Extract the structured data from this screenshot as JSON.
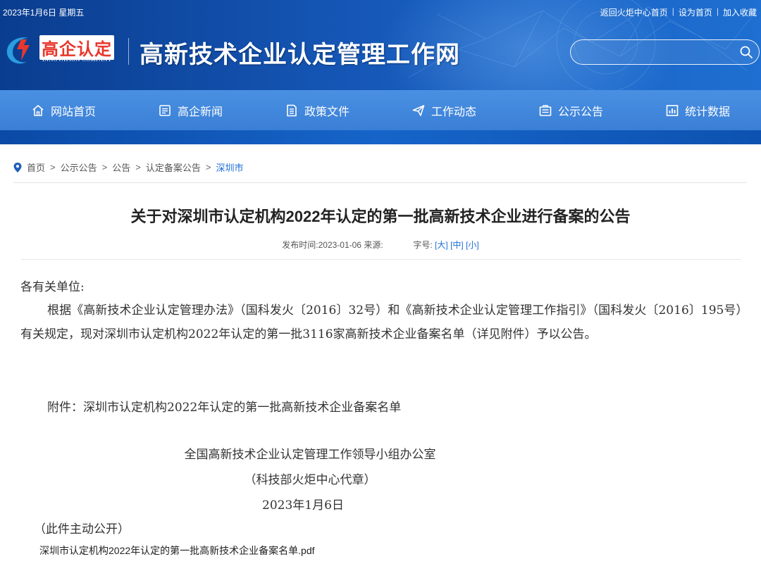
{
  "topbar": {
    "date": "2023年1月6日 星期五",
    "links": [
      "返回火炬中心首页",
      "设为首页",
      "加入收藏"
    ]
  },
  "logo": {
    "text": "高企认定",
    "sub": "INNOVATION COMPANY",
    "brand_color": "#e8372c"
  },
  "site_title": "高新技术企业认定管理工作网",
  "search": {
    "placeholder": ""
  },
  "nav": {
    "items": [
      {
        "label": "网站首页",
        "icon": "home-icon"
      },
      {
        "label": "高企新闻",
        "icon": "news-icon"
      },
      {
        "label": "政策文件",
        "icon": "document-icon"
      },
      {
        "label": "工作动态",
        "icon": "send-icon"
      },
      {
        "label": "公示公告",
        "icon": "announcement-icon"
      },
      {
        "label": "统计数据",
        "icon": "chart-icon"
      }
    ]
  },
  "breadcrumb": {
    "items": [
      "首页",
      "公示公告",
      "公告",
      "认定备案公告"
    ],
    "current": "深圳市",
    "separator": ">"
  },
  "article": {
    "title": "关于对深圳市认定机构2022年认定的第一批高新技术企业进行备案的公告",
    "meta": {
      "published_label": "发布时间:",
      "published_date": "2023-01-06",
      "source_label": "来源:",
      "font_size_label": "字号:",
      "size_large": "[大]",
      "size_medium": "[中]",
      "size_small": "[小]"
    },
    "salutation": "各有关单位:",
    "paragraph": "根据《高新技术企业认定管理办法》（国科发火〔2016〕32号）和《高新技术企业认定管理工作指引》（国科发火〔2016〕195号）有关规定，现对深圳市认定机构2022年认定的第一批3116家高新技术企业备案名单（详见附件）予以公告。",
    "attachment_line": "附件：深圳市认定机构2022年认定的第一批高新技术企业备案名单",
    "signature": "全国高新技术企业认定管理工作领导小组办公室",
    "signature_note": "（科技部火炬中心代章）",
    "sign_date": "2023年1月6日",
    "public_note": "（此件主动公开）",
    "attachment_file": "深圳市认定机构2022年认定的第一批高新技术企业备案名单.pdf"
  },
  "colors": {
    "header_bg": "#1556b5",
    "nav_bg": "#3f86dc",
    "link_blue": "#1e6ed6"
  }
}
